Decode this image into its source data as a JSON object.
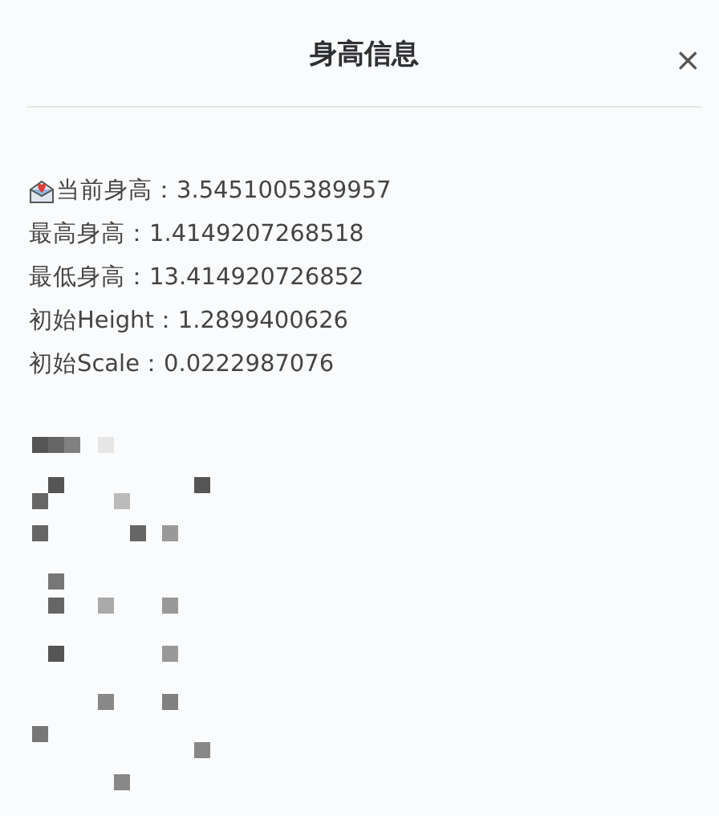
{
  "dialog": {
    "title": "身高信息",
    "close": "×"
  },
  "lines": [
    {
      "kind": "with-icon",
      "text": "当前身高：3.5451005389957"
    },
    {
      "kind": "plain",
      "text": "最高身高：1.4149207268518"
    },
    {
      "kind": "plain",
      "text": "最低身高：13.414920726852"
    },
    {
      "kind": "plain",
      "text": "初始Height：1.2899400626"
    },
    {
      "kind": "plain",
      "text": "初始Scale：0.0222987076"
    }
  ]
}
